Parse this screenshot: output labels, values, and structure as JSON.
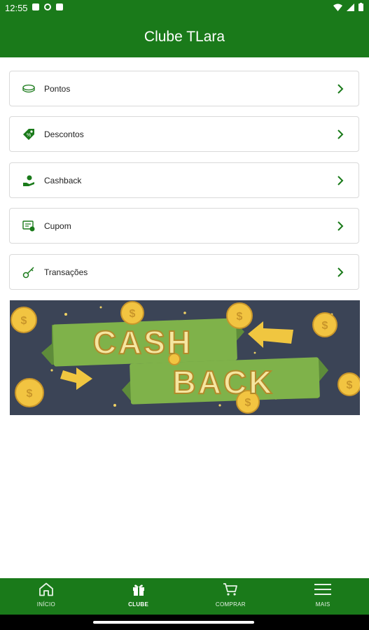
{
  "status_bar": {
    "time": "12:55"
  },
  "header": {
    "title": "Clube TLara"
  },
  "menu": [
    {
      "label": "Pontos",
      "icon": "coins-icon"
    },
    {
      "label": "Descontos",
      "icon": "discount-tag-icon"
    },
    {
      "label": "Cashback",
      "icon": "cashback-hand-icon"
    },
    {
      "label": "Cupom",
      "icon": "coupon-icon"
    },
    {
      "label": "Transações",
      "icon": "key-icon"
    }
  ],
  "banner": {
    "line1": "CASH",
    "line2": "BACK"
  },
  "bottom_nav": [
    {
      "label": "INÍCIO",
      "icon": "home-icon",
      "active": false
    },
    {
      "label": "CLUBE",
      "icon": "gift-icon",
      "active": true
    },
    {
      "label": "COMPRAR",
      "icon": "cart-icon",
      "active": false
    },
    {
      "label": "MAIS",
      "icon": "menu-icon",
      "active": false
    }
  ],
  "colors": {
    "primary": "#1a7a1a",
    "banner_bg": "#3b4456",
    "banner_ribbon": "#7fb24a",
    "banner_text": "#f5e6a0"
  }
}
